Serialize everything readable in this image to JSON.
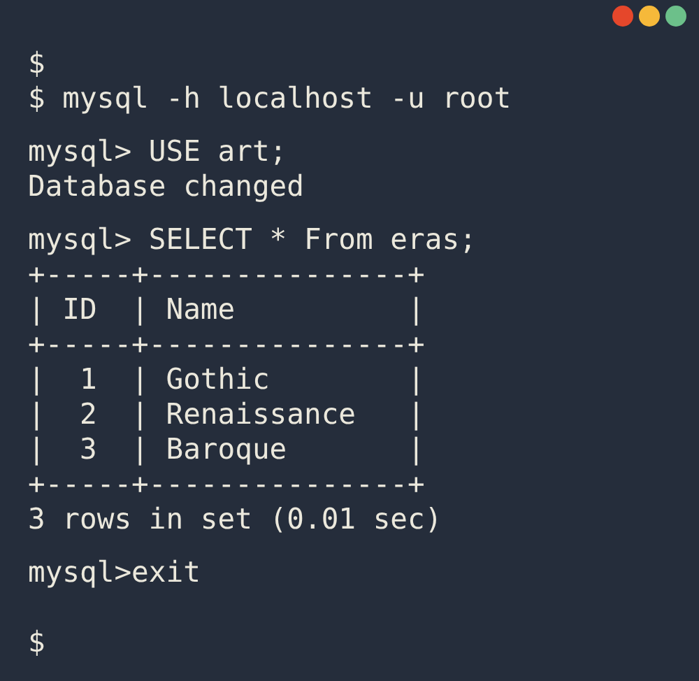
{
  "window_controls": [
    {
      "color": "#e5472b"
    },
    {
      "color": "#f6b93a"
    },
    {
      "color": "#6cc08a"
    }
  ],
  "blocks": [
    {
      "lines": [
        "$",
        "$ mysql -h localhost -u root"
      ]
    },
    {
      "lines": [
        "mysql> USE art;",
        "Database changed"
      ]
    },
    {
      "lines": [
        "mysql> SELECT * From eras;",
        "+-----+---------------+",
        "| ID  | Name          |",
        "+-----+---------------+",
        "|  1  | Gothic        |",
        "|  2  | Renaissance   |",
        "|  3  | Baroque       |",
        "+-----+---------------+",
        "3 rows in set (0.01 sec)"
      ]
    },
    {
      "lines": [
        "mysql>exit"
      ]
    },
    {
      "lines": [
        "$"
      ]
    }
  ]
}
